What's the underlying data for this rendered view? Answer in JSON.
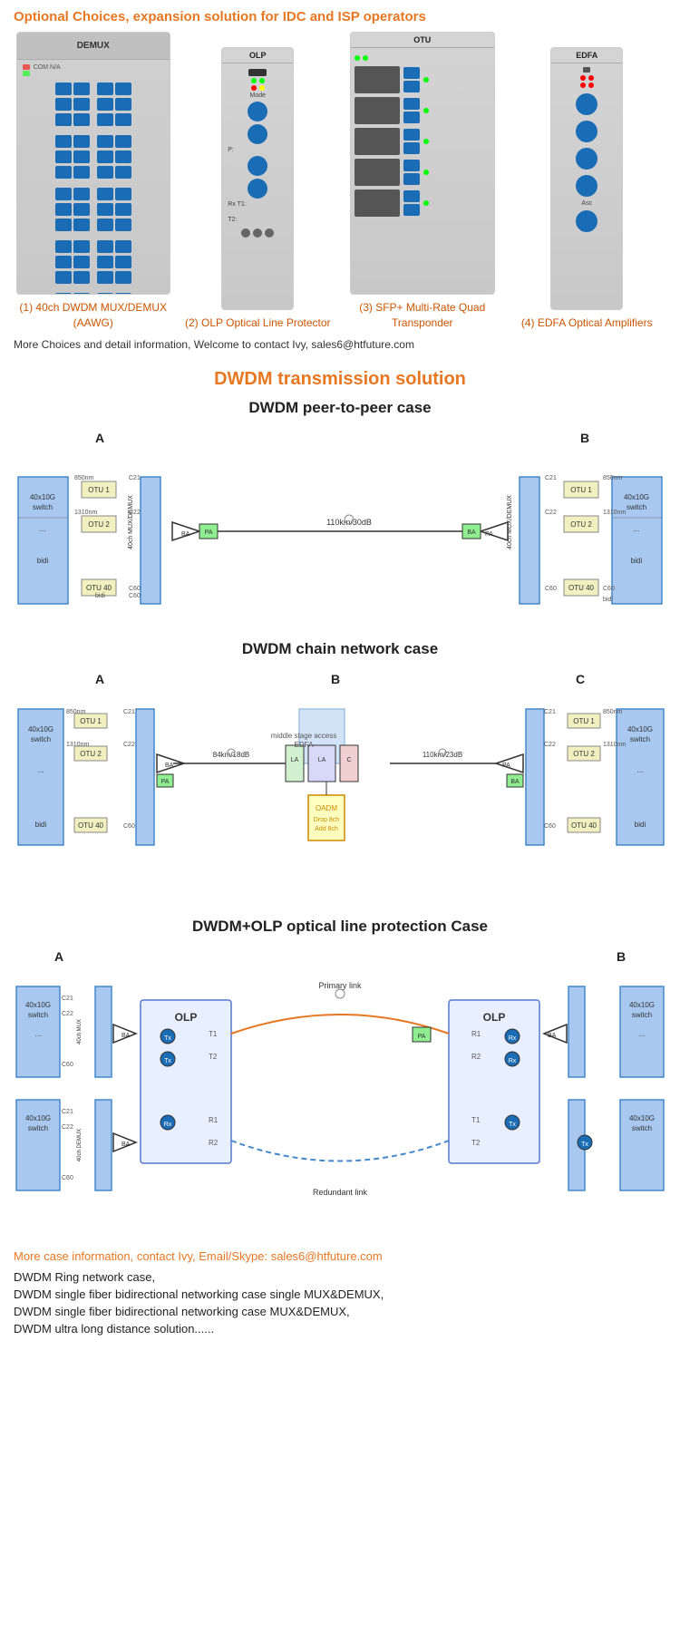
{
  "header": {
    "title": "Optional Choices, expansion solution for IDC and ISP operators"
  },
  "products": [
    {
      "id": "demux",
      "label": "(1) 40ch DWDM MUX/DEMUX (AAWG)"
    },
    {
      "id": "olp",
      "label": "(2) OLP Optical Line Protector"
    },
    {
      "id": "otu",
      "label": "(3) SFP+ Multi-Rate Quad Transponder"
    },
    {
      "id": "edfa",
      "label": "(4) EDFA Optical Amplifiers"
    }
  ],
  "contact_line": "More Choices and detail information, Welcome to contact Ivy, sales6@htfuture.com",
  "dwdm_title": "DWDM transmission solution",
  "diagrams": [
    {
      "title": "DWDM peer-to-peer case"
    },
    {
      "title": "DWDM chain network case"
    },
    {
      "title": "DWDM+OLP optical line protection Case"
    }
  ],
  "bottom": {
    "more_info": "More case information, contact Ivy, Email/Skype:  sales6@htfuture.com",
    "bullets": [
      "DWDM Ring network case,",
      "DWDM single fiber bidirectional networking case single MUX&DEMUX,",
      "DWDM single fiber bidirectional networking case MUX&DEMUX,",
      "DWDM ultra long distance solution......"
    ]
  }
}
